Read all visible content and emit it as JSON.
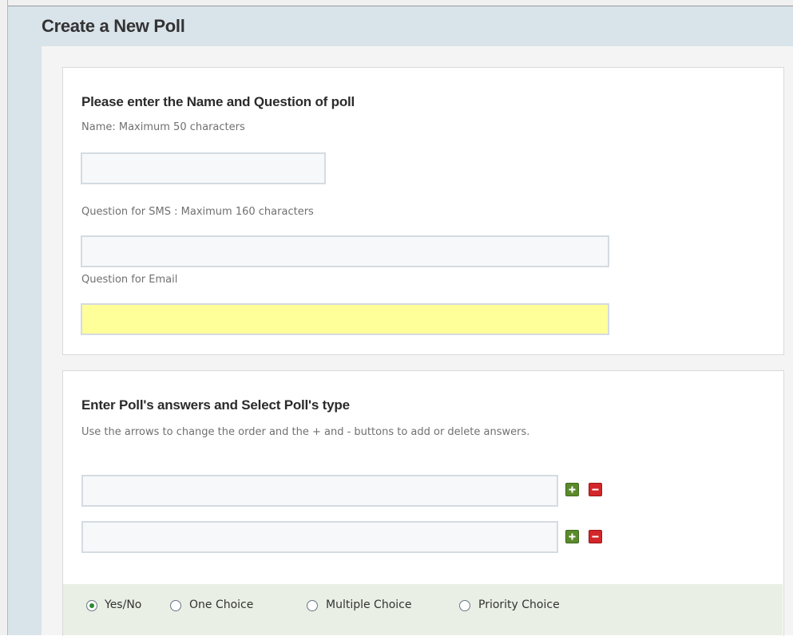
{
  "page": {
    "title": "Create a New Poll"
  },
  "name_question_section": {
    "title": "Please enter the Name and Question of poll",
    "name_hint": "Name: Maximum 50 characters",
    "name_value": "",
    "sms_hint": "Question for SMS : Maximum 160 characters",
    "sms_value": "",
    "email_hint": "Question for Email",
    "email_value": ""
  },
  "answers_section": {
    "title": "Enter Poll's answers and Select Poll's type",
    "hint": "Use the arrows to change the order and the + and - buttons to add or delete answers.",
    "answers": [
      {
        "value": ""
      },
      {
        "value": ""
      }
    ]
  },
  "poll_types": {
    "selected": "Yes/No",
    "options": [
      "Yes/No",
      "One Choice",
      "Multiple Choice",
      "Priority Choice"
    ]
  },
  "icons": {
    "add": "plus-icon",
    "remove": "minus-icon"
  },
  "colors": {
    "header_bg": "#d9e3ea",
    "highlight_field": "#ffff99",
    "add_button": "#5b8a2c",
    "remove_button": "#d3262a",
    "type_bar_bg": "#e9efe4",
    "radio_selected": "#2f8a2f"
  }
}
